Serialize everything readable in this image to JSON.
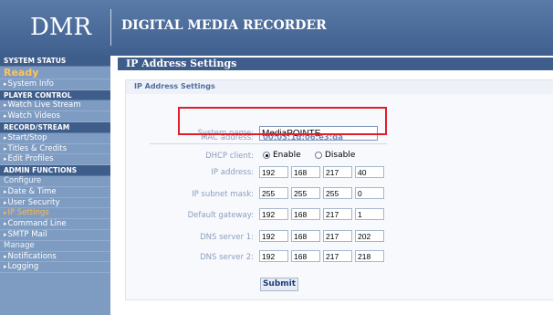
{
  "header": {
    "logo": "DMR",
    "title": "DIGITAL MEDIA RECORDER"
  },
  "sidebar": {
    "items": [
      {
        "label": "SYSTEM STATUS",
        "kind": "header"
      },
      {
        "label": "Ready",
        "kind": "status"
      },
      {
        "label": "System Info",
        "kind": "link"
      },
      {
        "label": "PLAYER CONTROL",
        "kind": "header"
      },
      {
        "label": "Watch Live Stream",
        "kind": "link"
      },
      {
        "label": "Watch Videos",
        "kind": "link"
      },
      {
        "label": "RECORD/STREAM",
        "kind": "header"
      },
      {
        "label": "Start/Stop",
        "kind": "link"
      },
      {
        "label": "Titles & Credits",
        "kind": "link"
      },
      {
        "label": "Edit Profiles",
        "kind": "link"
      },
      {
        "label": "ADMIN FUNCTIONS",
        "kind": "header"
      },
      {
        "label": "Configure",
        "kind": "plain"
      },
      {
        "label": "Date & Time",
        "kind": "link"
      },
      {
        "label": "User Security",
        "kind": "link"
      },
      {
        "label": "IP Settings",
        "kind": "active"
      },
      {
        "label": "Command Line",
        "kind": "link"
      },
      {
        "label": "SMTP Mail",
        "kind": "link"
      },
      {
        "label": "Manage",
        "kind": "plain"
      },
      {
        "label": "Notifications",
        "kind": "link"
      },
      {
        "label": "Logging",
        "kind": "link"
      }
    ]
  },
  "page": {
    "tab_title": "IP Address Settings",
    "panel_title": "IP Address Settings"
  },
  "form": {
    "system_name_label": "System name:",
    "system_name_value": "MediaPOINTE",
    "mac_label": "MAC address:",
    "mac_value": "00:03:1d:06:e3:da",
    "dhcp_label": "DHCP client:",
    "dhcp_enable": "Enable",
    "dhcp_disable": "Disable",
    "dhcp_selected": "Enable",
    "ip_label": "IP address:",
    "ip": [
      "192",
      "168",
      "217",
      "40"
    ],
    "mask_label": "IP subnet mask:",
    "mask": [
      "255",
      "255",
      "255",
      "0"
    ],
    "gateway_label": "Default gateway:",
    "gateway": [
      "192",
      "168",
      "217",
      "1"
    ],
    "dns1_label": "DNS server 1:",
    "dns1": [
      "192",
      "168",
      "217",
      "202"
    ],
    "dns2_label": "DNS server 2:",
    "dns2": [
      "192",
      "168",
      "217",
      "218"
    ],
    "submit_label": "Submit"
  },
  "colors": {
    "header_bg": "#4a6b9a",
    "sidebar_bg": "#7e9cc2",
    "active": "#ffb84a",
    "highlight": "#e11d2a"
  }
}
